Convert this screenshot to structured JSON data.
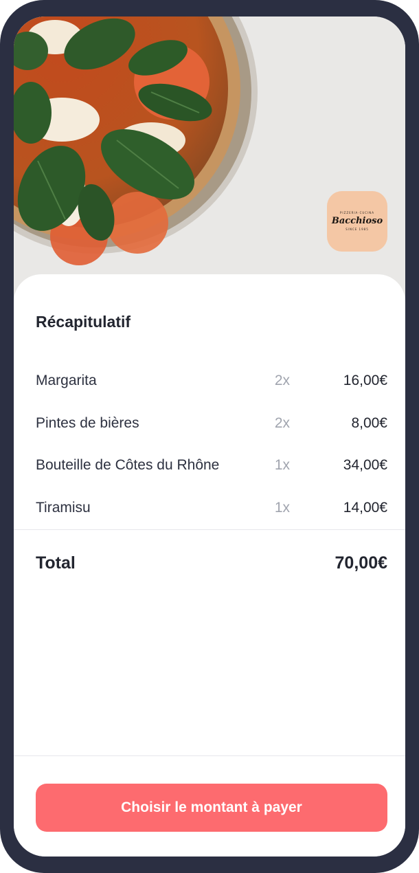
{
  "restaurant": {
    "logo_top": "PIZZERIA·CUCINA",
    "logo_name": "Bacchioso",
    "logo_bottom": "SINCE 1985"
  },
  "summary": {
    "title": "Récapitulatif",
    "items": [
      {
        "name": "Margarita",
        "qty": "2x",
        "price": "16,00€"
      },
      {
        "name": "Pintes de bières",
        "qty": "2x",
        "price": "8,00€"
      },
      {
        "name": "Bouteille de Côtes du Rhône",
        "qty": "1x",
        "price": "34,00€"
      },
      {
        "name": "Tiramisu",
        "qty": "1x",
        "price": "14,00€"
      }
    ],
    "total_label": "Total",
    "total_value": "70,00€"
  },
  "cta": {
    "label": "Choisir le montant à payer"
  },
  "colors": {
    "frame": "#2b2f42",
    "accent": "#fd6b6f",
    "logo_badge": "#f4c7a5"
  }
}
